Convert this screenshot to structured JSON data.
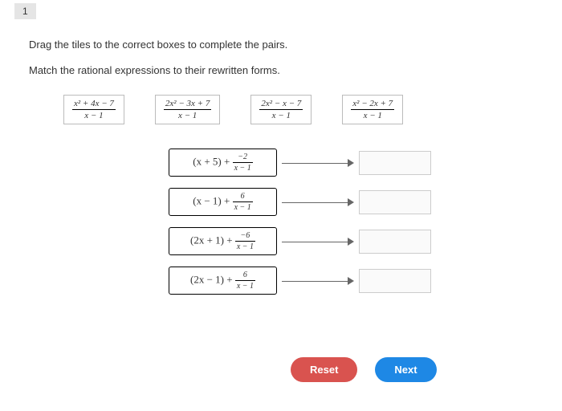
{
  "page_number": "1",
  "instruction1": "Drag the tiles to the correct boxes to complete the pairs.",
  "instruction2": "Match the rational expressions to their rewritten forms.",
  "tiles": [
    {
      "num": "x² + 4x − 7",
      "den": "x − 1"
    },
    {
      "num": "2x² − 3x + 7",
      "den": "x − 1"
    },
    {
      "num": "2x² − x − 7",
      "den": "x − 1"
    },
    {
      "num": "x² − 2x + 7",
      "den": "x − 1"
    }
  ],
  "pairs": [
    {
      "poly": "(x + 5) + ",
      "frac_num": "−2",
      "frac_den": "x − 1"
    },
    {
      "poly": "(x − 1) + ",
      "frac_num": "6",
      "frac_den": "x − 1"
    },
    {
      "poly": "(2x + 1) + ",
      "frac_num": "−6",
      "frac_den": "x − 1"
    },
    {
      "poly": "(2x − 1) + ",
      "frac_num": "6",
      "frac_den": "x − 1"
    }
  ],
  "buttons": {
    "reset": "Reset",
    "next": "Next"
  },
  "chart_data": {
    "type": "table",
    "description": "Matching exercise: rational expressions to rewritten (quotient + remainder) forms",
    "tiles": [
      "(x² + 4x − 7)/(x − 1)",
      "(2x² − 3x + 7)/(x − 1)",
      "(2x² − x − 7)/(x − 1)",
      "(x² − 2x + 7)/(x − 1)"
    ],
    "targets": [
      "(x + 5) + (−2)/(x − 1)",
      "(x − 1) + 6/(x − 1)",
      "(2x + 1) + (−6)/(x − 1)",
      "(2x − 1) + 6/(x − 1)"
    ]
  }
}
